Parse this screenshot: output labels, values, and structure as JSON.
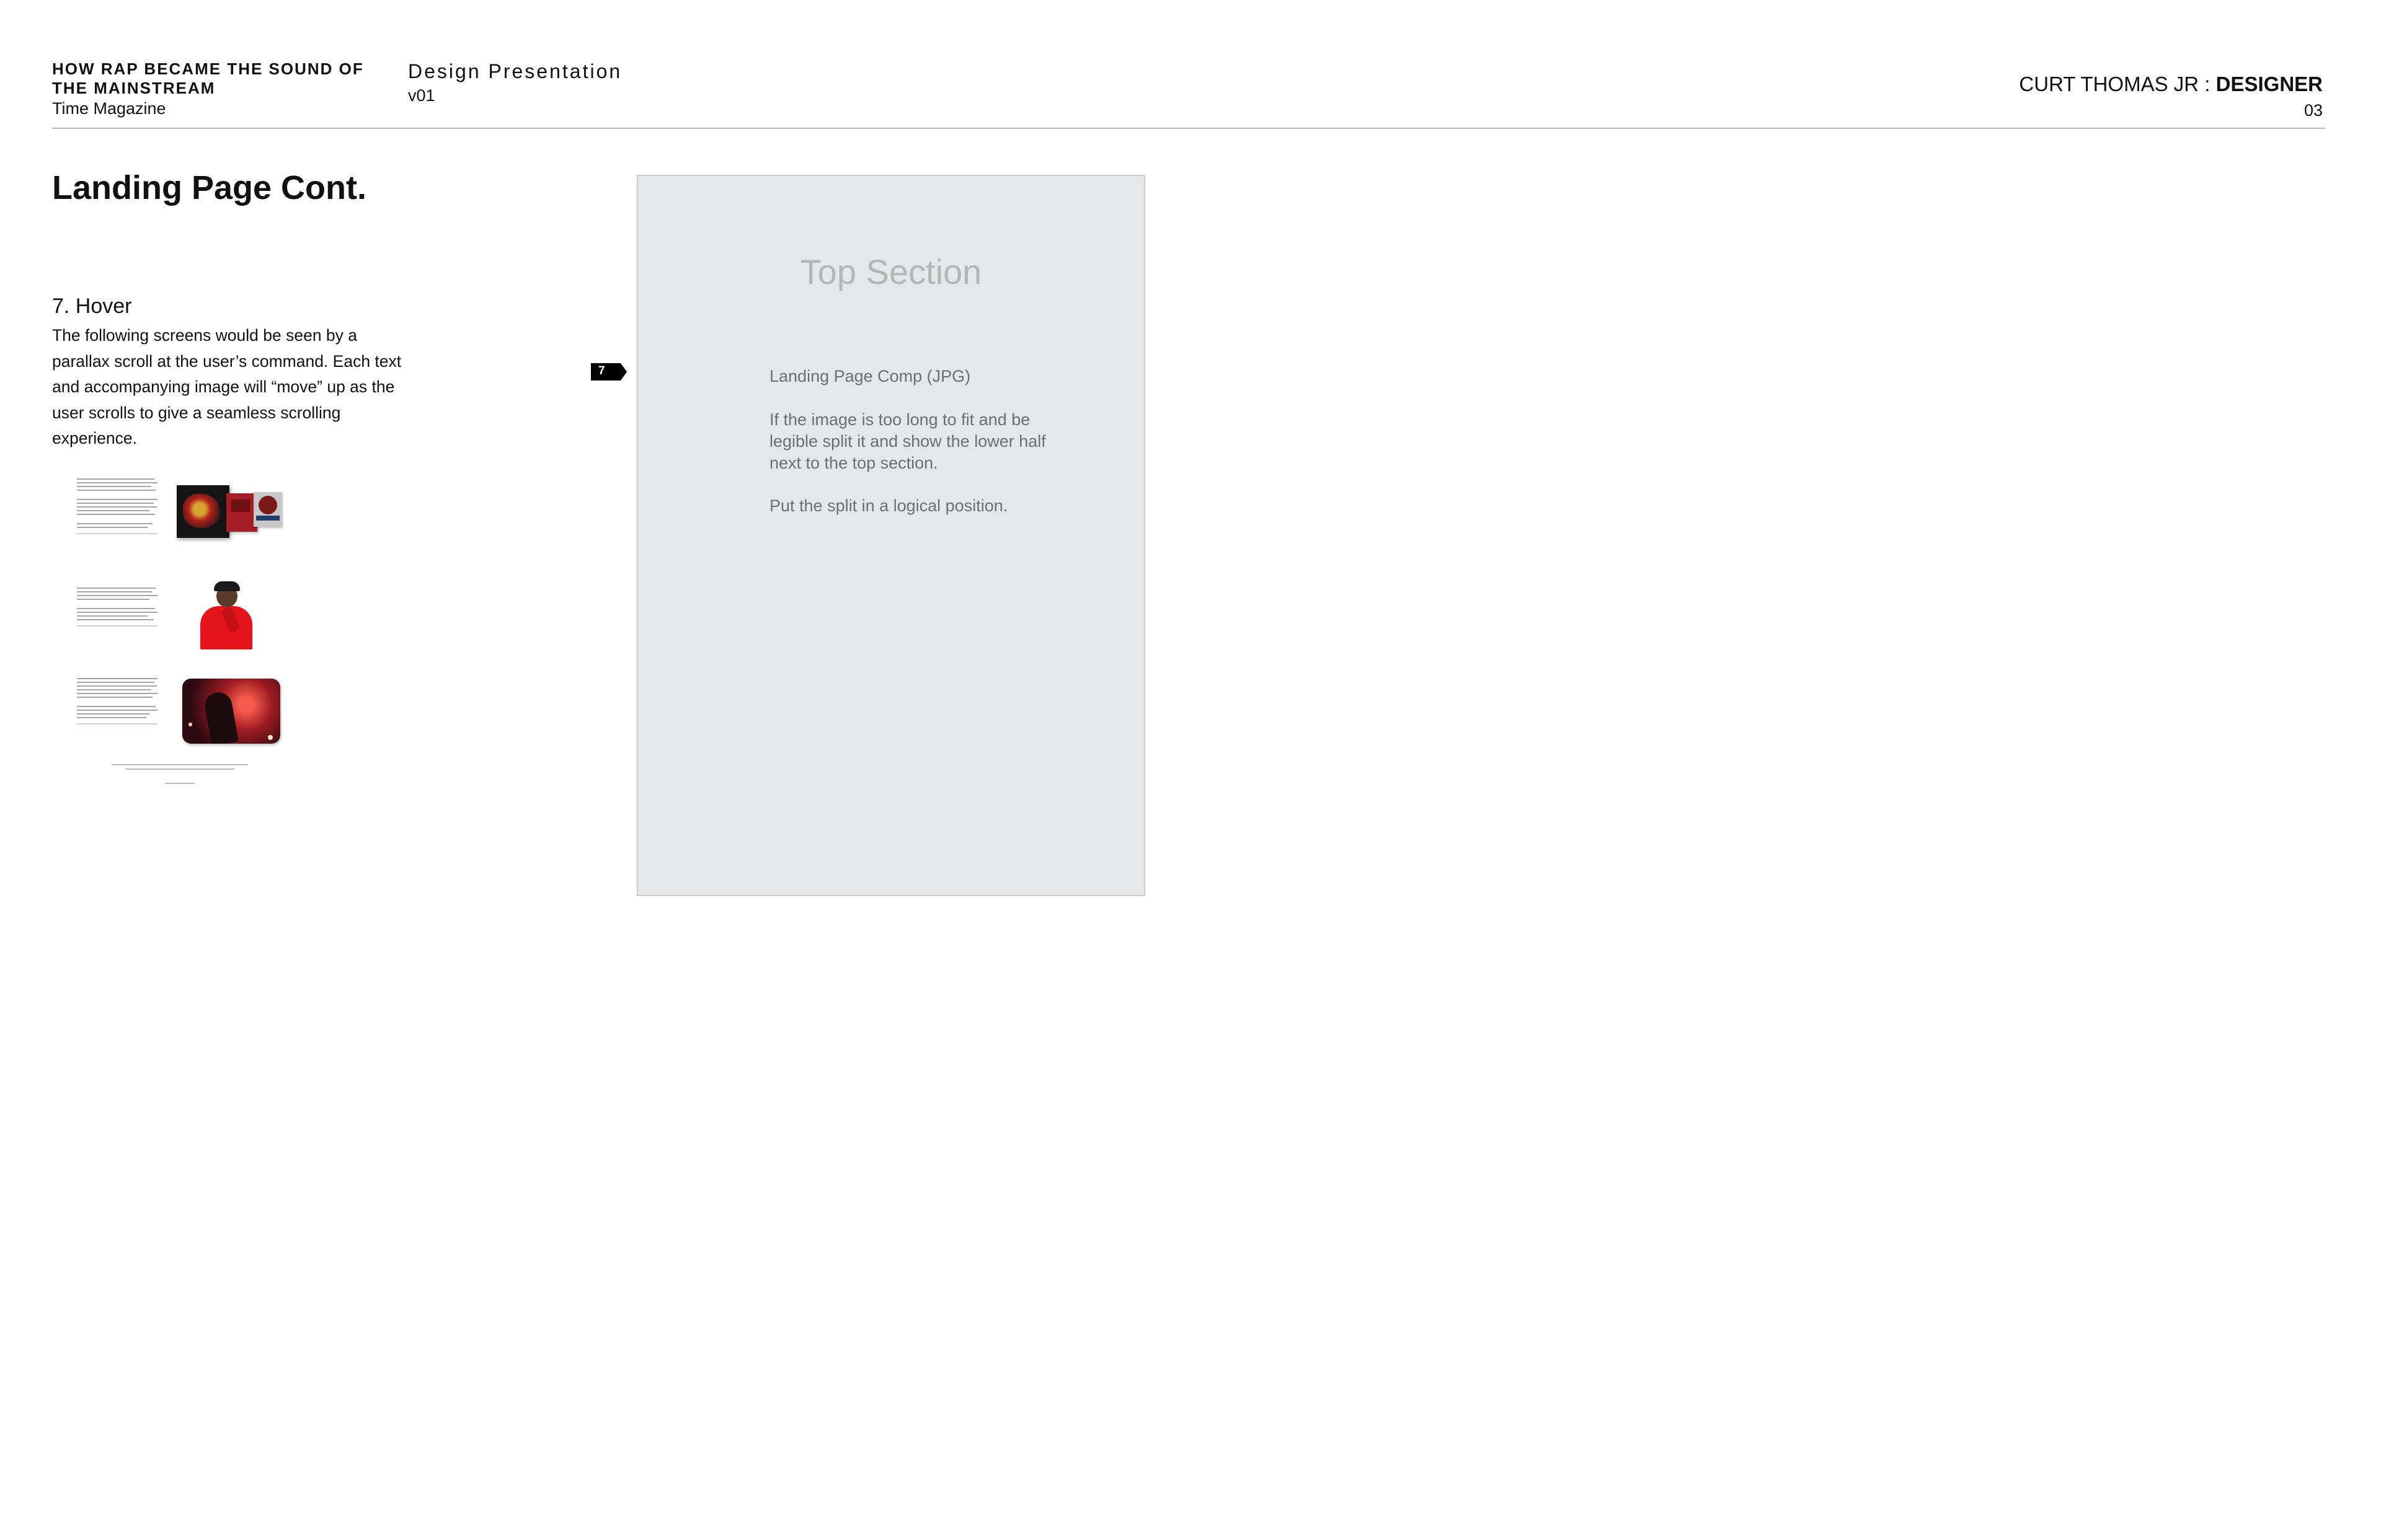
{
  "header": {
    "project_title": "HOW RAP BECAME THE SOUND OF THE MAINSTREAM",
    "client": "Time Magazine",
    "document_type": "Design Presentation",
    "version": "v01",
    "designer_name": "CURT THOMAS JR",
    "designer_separator": " : ",
    "designer_role": "DESIGNER",
    "page_number": "03"
  },
  "section": {
    "title": "Landing Page Cont.",
    "step_title": "7. Hover",
    "step_body": "The following screens would be seen by a parallax scroll at the user’s command. Each text and accompanying image will “move” up as the user scrolls to give a seamless scrolling experience."
  },
  "thumbnails": [
    {
      "image_icon": "album-covers-image"
    },
    {
      "image_icon": "rapper-red-hoodie-image"
    },
    {
      "image_icon": "concert-performer-image"
    }
  ],
  "marker": {
    "label": "7"
  },
  "panel": {
    "title": "Top Section",
    "comp_label": "Landing Page Comp (JPG)",
    "note_fit": "If the image is too long to fit and be legible split it and show the lower half next to the top section.",
    "note_split": "Put the split in a logical position."
  },
  "colors": {
    "panel_background": "#e6e7e8",
    "rule": "#b9b9b9",
    "marker": "#000000"
  }
}
